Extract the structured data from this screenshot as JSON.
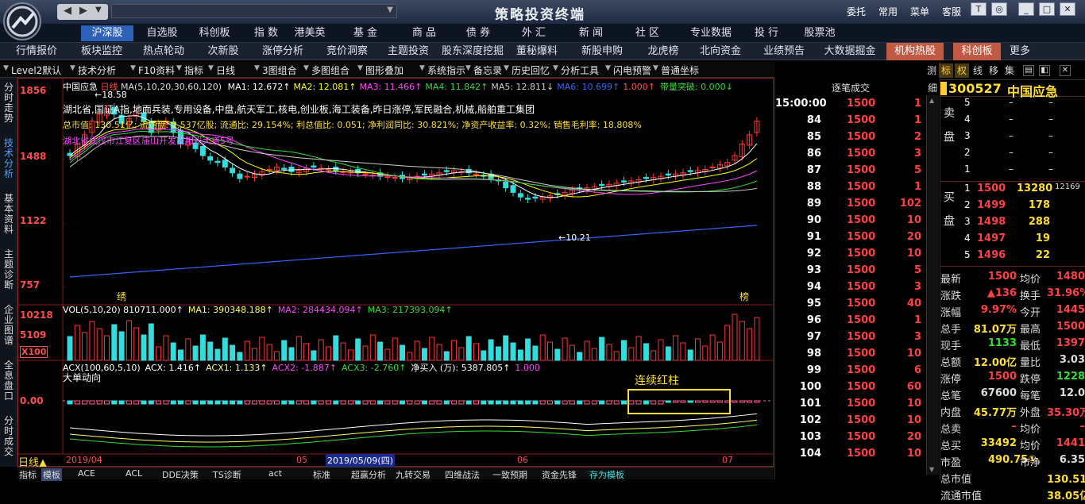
{
  "app": {
    "title": "策略投资终端",
    "top_menu": [
      "委托",
      "常用",
      "菜单",
      "客服"
    ]
  },
  "nav_tabs": [
    {
      "label": "沪深股",
      "active": true
    },
    {
      "label": "自选股"
    },
    {
      "label": "科创板"
    },
    {
      "label": "指 数"
    },
    {
      "label": "港美英"
    },
    {
      "label": "基 金"
    },
    {
      "label": "商 品"
    },
    {
      "label": "债 券"
    },
    {
      "label": "外 汇"
    },
    {
      "label": "新 闻"
    },
    {
      "label": "社 区"
    },
    {
      "label": "专业数据"
    },
    {
      "label": "投 行"
    },
    {
      "label": "股票池"
    }
  ],
  "sub_tabs": [
    "行情报价",
    "板块监控",
    "热点轮动",
    "次新股",
    "涨停分析",
    "竞价洞察",
    "主题投资",
    "股东深度挖掘",
    "董秘爆料",
    "新股申购",
    "龙虎榜",
    "北向资金",
    "业绩预告",
    "大数据掘金",
    "机构热股",
    "科创板",
    "更多"
  ],
  "toolbar": [
    "Level2默认",
    "技术分析",
    "F10资料",
    "指标",
    "日线",
    "3图组合",
    "多图组合",
    "图形叠加",
    "系统指示",
    "备忘录",
    "历史回忆",
    "分析工具",
    "闪电预警",
    "普通坐标"
  ],
  "left_tabs": [
    {
      "label": "分时走势"
    },
    {
      "label": "技术分析",
      "active": true
    },
    {
      "label": "基本资料"
    },
    {
      "label": "主题诊断"
    },
    {
      "label": "企业图谱"
    },
    {
      "label": "全息盘口"
    },
    {
      "label": "分时成交"
    }
  ],
  "chart": {
    "header": "中国应急 日线 MA(5,10,20,30,60,120) MA1: 12.672↑ MA2: 12.081↑ MA3: 11.466↑ MA4: 11.842↑ MA5: 12.811↓ MA6: 10.699↑ 1.000↑ 带量突破: 0.000↓",
    "ma_values": [
      {
        "label": "MA1: 12.672↑",
        "color": "#ffffff"
      },
      {
        "label": "MA2: 12.081↑",
        "color": "#ffff00"
      },
      {
        "label": "MA3: 11.466↑",
        "color": "#ff44ff"
      },
      {
        "label": "MA4: 11.842↑",
        "color": "#33dd33"
      },
      {
        "label": "MA5: 12.811↓",
        "color": "#cccccc"
      },
      {
        "label": "MA6: 10.699↑",
        "color": "#3366ff"
      }
    ],
    "info_line1": "湖北省,国证A指,地面兵装,专用设备,中盘,航天军工,核电,创业板,海工装备,昨日涨停,军民融合,机械,船舶重工集团",
    "info_line2": "总市值: 130.51亿; 流通盘: 2.537亿股; 流通比: 29.154%; 利总值比: 0.051; 净利润同比: 30.821%; 净资产收益率: 0.32%; 销售毛利率: 18.808%",
    "info_line3": "湖北省武汉市江夏区庙山开发区阳光大道5号",
    "price_labels": [
      "1856",
      "1488",
      "1122",
      "757"
    ],
    "high_mark": "18.58",
    "low_mark": "10.21",
    "left_tag": "绣",
    "right_tag": "榜",
    "vol_header": "VOL(5,10,20) 810711.000↑ MA1: 390348.188↑ MA2: 284434.094↑ MA3: 217393.094↑",
    "vol_labels": [
      "10218",
      "5109",
      "X100"
    ],
    "acx_header": "ACX(100,60,5,10) ACX: 1.416↑ ACX1: 1.133↑ ACX2: -1.887↑ ACX3: -2.760↑ 净买入 (万): 5387.805↑ 1.000",
    "acx_title": "大单动向",
    "acx_zero": "0.00",
    "annotation": "连续红柱",
    "date_axis": [
      "2019/04",
      "05",
      "2019/05/09(四)",
      "06",
      "07"
    ],
    "period_label": "日线"
  },
  "bottom_tabs": [
    "指标",
    "模板",
    "ACE",
    "ACL",
    "DDE决策",
    "TS诊断",
    "act",
    "标准",
    "超赢分析",
    "九转交易",
    "四维战法",
    "一致预期",
    "资金先锋",
    "存为模板"
  ],
  "tick": {
    "header": "逐笔成交",
    "col_label": "细",
    "rows": [
      {
        "t": "15:00:00",
        "p": "1500",
        "v": "1"
      },
      {
        "t": "84",
        "p": "1500",
        "v": "1"
      },
      {
        "t": "85",
        "p": "1500",
        "v": "2"
      },
      {
        "t": "86",
        "p": "1500",
        "v": "3"
      },
      {
        "t": "87",
        "p": "1500",
        "v": "5"
      },
      {
        "t": "88",
        "p": "1500",
        "v": "1"
      },
      {
        "t": "89",
        "p": "1500",
        "v": "102"
      },
      {
        "t": "90",
        "p": "1500",
        "v": "10"
      },
      {
        "t": "91",
        "p": "1500",
        "v": "20"
      },
      {
        "t": "92",
        "p": "1500",
        "v": "10"
      },
      {
        "t": "93",
        "p": "1500",
        "v": "5"
      },
      {
        "t": "94",
        "p": "1500",
        "v": "3"
      },
      {
        "t": "95",
        "p": "1500",
        "v": "40"
      },
      {
        "t": "96",
        "p": "1500",
        "v": "1"
      },
      {
        "t": "97",
        "p": "1500",
        "v": "3"
      },
      {
        "t": "98",
        "p": "1500",
        "v": "10"
      },
      {
        "t": "99",
        "p": "1500",
        "v": "6"
      },
      {
        "t": "100",
        "p": "1500",
        "v": "60"
      },
      {
        "t": "101",
        "p": "1500",
        "v": "10"
      },
      {
        "t": "102",
        "p": "1500",
        "v": "10"
      },
      {
        "t": "103",
        "p": "1500",
        "v": "20"
      },
      {
        "t": "104",
        "p": "1500",
        "v": "10"
      }
    ]
  },
  "quote": {
    "tabs": [
      "测",
      "标",
      "权",
      "线",
      "移",
      "集"
    ],
    "code": "300527",
    "name": "中国应急",
    "sell_label": "卖盘",
    "buy_label": "买盘",
    "sells": [
      {
        "n": "5",
        "p": "–",
        "v": "–"
      },
      {
        "n": "4",
        "p": "–",
        "v": "–"
      },
      {
        "n": "3",
        "p": "–",
        "v": "–"
      },
      {
        "n": "2",
        "p": "–",
        "v": "–"
      },
      {
        "n": "1",
        "p": "–",
        "v": "–"
      }
    ],
    "buys": [
      {
        "n": "1",
        "p": "1500",
        "v": "13280",
        "x": "12169"
      },
      {
        "n": "2",
        "p": "1499",
        "v": "178",
        "x": ""
      },
      {
        "n": "3",
        "p": "1498",
        "v": "288",
        "x": ""
      },
      {
        "n": "4",
        "p": "1497",
        "v": "19",
        "x": ""
      },
      {
        "n": "5",
        "p": "1496",
        "v": "22",
        "x": ""
      }
    ],
    "stats": [
      {
        "l1": "最新",
        "v1": "1500",
        "l2": "均价",
        "v2": "1480"
      },
      {
        "l1": "涨跌",
        "v1": "▲136",
        "l2": "换手",
        "v2": "31.96%"
      },
      {
        "l1": "涨幅",
        "v1": "9.97%",
        "l2": "今开",
        "v2": "1445"
      },
      {
        "l1": "总手",
        "v1": "81.07万",
        "l2": "最高",
        "v2": "1500"
      },
      {
        "l1": "现手",
        "v1": "1133",
        "l2": "最低",
        "v2": "1397"
      },
      {
        "l1": "总额",
        "v1": "12.00亿",
        "l2": "量比",
        "v2": "3.03"
      },
      {
        "l1": "涨停",
        "v1": "1500",
        "l2": "跌停",
        "v2": "1228"
      },
      {
        "l1": "总笔",
        "v1": "67600",
        "l2": "每笔",
        "v2": "12.0"
      },
      {
        "l1": "内盘",
        "v1": "45.77万",
        "l2": "外盘",
        "v2": "35.30万"
      },
      {
        "l1": "总卖",
        "v1": "–",
        "l2": "均价",
        "v2": "–"
      },
      {
        "l1": "总买",
        "v1": "33492",
        "l2": "均价",
        "v2": "1441"
      },
      {
        "l1": "市盈",
        "v1": "490.75①",
        "l2": "市净",
        "v2": "6.35"
      },
      {
        "l1": "总市值",
        "v1": "",
        "l2": "",
        "v2": "130.51亿"
      },
      {
        "l1": "流通市值",
        "v1": "",
        "l2": "",
        "v2": "38.05亿"
      }
    ]
  },
  "colors": {
    "up": "#ff3333",
    "down": "#33dddd",
    "grid": "#8b1a1a",
    "accent": "#2d62b8"
  }
}
